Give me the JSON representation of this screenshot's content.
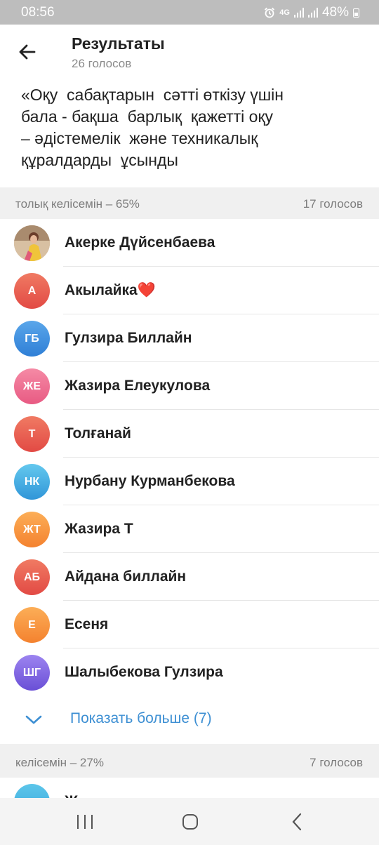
{
  "status_bar": {
    "time": "08:56",
    "net_label": "4G",
    "battery": "48%"
  },
  "header": {
    "title": "Результаты",
    "subtitle": "26 голосов"
  },
  "question": "«Оқу  сабақтарын  сәтті өткізу үшін\nбала - бақша  барлық  қажетті оқу\n– әдістемелік  және техникалық\nқұралдарды  ұсынды",
  "sections": [
    {
      "option": "толық келісемін – 65%",
      "votes": "17 голосов",
      "voters": [
        {
          "initials": "",
          "name": "Акерке Дүйсенбаева",
          "photo": true
        },
        {
          "initials": "А",
          "name": "Акылайка❤️",
          "color": "#ea5b4c"
        },
        {
          "initials": "ГБ",
          "name": "Гулзира Биллайн",
          "color": "#3b8fdc"
        },
        {
          "initials": "ЖЕ",
          "name": "Жазира Елеукулова",
          "color": "#ef6a8c"
        },
        {
          "initials": "Т",
          "name": "Толғанай",
          "color": "#ea5b4c"
        },
        {
          "initials": "НК",
          "name": "Нурбану Курманбекова",
          "color": "#3aa6dc"
        },
        {
          "initials": "ЖТ",
          "name": "Жазира Т",
          "color": "#f89a3a"
        },
        {
          "initials": "АБ",
          "name": "Айдана биллайн",
          "color": "#ea5b4c"
        },
        {
          "initials": "Е",
          "name": "Есеня",
          "color": "#f89a3a"
        },
        {
          "initials": "ШГ",
          "name": "Шалыбекова Гулзира",
          "color": "#7c61df"
        }
      ],
      "show_more": "Показать больше (7)"
    },
    {
      "option": "келісемін – 27%",
      "votes": "7 голосов",
      "voters": [
        {
          "initials": "Ж",
          "name": "Ж"
        }
      ]
    }
  ]
}
